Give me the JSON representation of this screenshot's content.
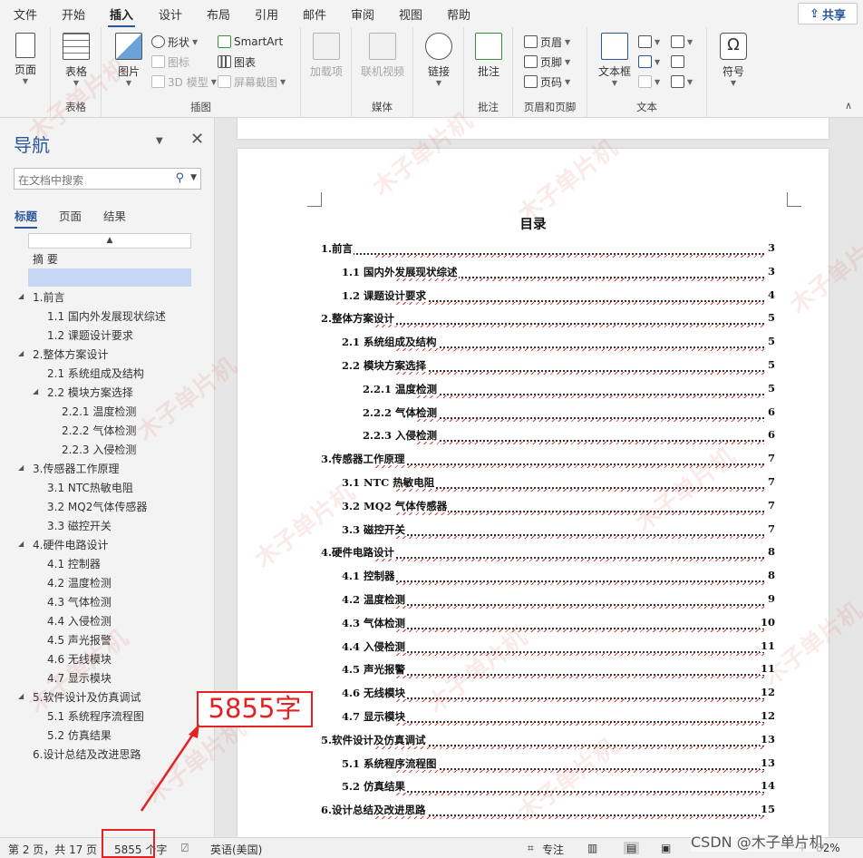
{
  "ribbon_tabs": [
    "文件",
    "开始",
    "插入",
    "设计",
    "布局",
    "引用",
    "邮件",
    "审阅",
    "视图",
    "帮助"
  ],
  "active_tab": "插入",
  "share_label": "共享",
  "ribbon": {
    "pages": {
      "label": "页面",
      "group": ""
    },
    "tables": {
      "label": "表格",
      "group": "表格"
    },
    "illustrations": {
      "picture": "图片",
      "shapes": "形状",
      "icons": "图标",
      "model3d": "3D 模型",
      "smartart": "SmartArt",
      "chart": "图表",
      "screenshot": "屏幕截图",
      "group": "插图"
    },
    "addins": {
      "label": "加载项"
    },
    "media": {
      "video": "联机视频",
      "group": "媒体"
    },
    "links": {
      "label": "链接"
    },
    "comments": {
      "label": "批注",
      "group": "批注"
    },
    "header_footer": {
      "header": "页眉",
      "footer": "页脚",
      "page_number": "页码",
      "group": "页眉和页脚"
    },
    "text": {
      "textbox": "文本框",
      "group": "文本"
    },
    "symbols": {
      "label": "符号"
    }
  },
  "nav": {
    "title": "导航",
    "search_placeholder": "在文档中搜索",
    "tabs": [
      "标题",
      "页面",
      "结果"
    ],
    "items": [
      {
        "text": "摘 要"
      },
      {
        "text": "1.前言"
      },
      {
        "text": "1.1 国内外发展现状综述"
      },
      {
        "text": "1.2 课题设计要求"
      },
      {
        "text": "2.整体方案设计"
      },
      {
        "text": "2.1 系统组成及结构"
      },
      {
        "text": "2.2 模块方案选择"
      },
      {
        "text": "2.2.1 温度检测"
      },
      {
        "text": "2.2.2 气体检测"
      },
      {
        "text": "2.2.3 入侵检测"
      },
      {
        "text": "3.传感器工作原理"
      },
      {
        "text": "3.1 NTC热敏电阻"
      },
      {
        "text": "3.2 MQ2气体传感器"
      },
      {
        "text": "3.3 磁控开关"
      },
      {
        "text": "4.硬件电路设计"
      },
      {
        "text": "4.1 控制器"
      },
      {
        "text": "4.2 温度检测"
      },
      {
        "text": "4.3 气体检测"
      },
      {
        "text": "4.4 入侵检测"
      },
      {
        "text": "4.5 声光报警"
      },
      {
        "text": "4.6 无线模块"
      },
      {
        "text": "4.7 显示模块"
      },
      {
        "text": "5.软件设计及仿真调试"
      },
      {
        "text": "5.1 系统程序流程图"
      },
      {
        "text": "5.2 仿真结果"
      },
      {
        "text": "6.设计总结及改进思路"
      }
    ]
  },
  "document": {
    "toc_title": "目录",
    "toc": [
      {
        "text": "1.前言",
        "page": "3"
      },
      {
        "text": "1.1  国内外发展现状综述",
        "page": "3"
      },
      {
        "text": "1.2  课题设计要求",
        "page": "4"
      },
      {
        "text": "2.整体方案设计",
        "page": "5"
      },
      {
        "text": "2.1  系统组成及结构",
        "page": "5"
      },
      {
        "text": "2.2  模块方案选择",
        "page": "5"
      },
      {
        "text": "2.2.1  温度检测",
        "page": "5"
      },
      {
        "text": "2.2.2  气体检测",
        "page": "6"
      },
      {
        "text": "2.2.3  入侵检测",
        "page": "6"
      },
      {
        "text": "3.传感器工作原理",
        "page": "7"
      },
      {
        "text": "3.1 NTC 热敏电阻",
        "page": "7"
      },
      {
        "text": "3.2 MQ2 气体传感器",
        "page": "7"
      },
      {
        "text": "3.3  磁控开关",
        "page": "7"
      },
      {
        "text": "4.硬件电路设计",
        "page": "8"
      },
      {
        "text": "4.1  控制器",
        "page": "8"
      },
      {
        "text": "4.2  温度检测",
        "page": "9"
      },
      {
        "text": "4.3  气体检测",
        "page": "10"
      },
      {
        "text": "4.4  入侵检测",
        "page": "11"
      },
      {
        "text": "4.5  声光报警",
        "page": "11"
      },
      {
        "text": "4.6  无线模块",
        "page": "12"
      },
      {
        "text": "4.7  显示模块",
        "page": "12"
      },
      {
        "text": "5.软件设计及仿真调试",
        "page": "13"
      },
      {
        "text": "5.1  系统程序流程图",
        "page": "13"
      },
      {
        "text": "5.2  仿真结果",
        "page": "14"
      },
      {
        "text": "6.设计总结及改进思路",
        "page": "15"
      }
    ]
  },
  "status": {
    "page_info": "第 2 页，共 17 页",
    "word_count": "5855 个字",
    "language": "英语(美国)",
    "focus": "专注",
    "zoom": "82%"
  },
  "annotation": {
    "label": "5855字"
  },
  "watermark": "木子单片机",
  "credit": "CSDN @木子单片机",
  "colors": {
    "accent": "#2b579a",
    "annotation": "#e52222"
  }
}
